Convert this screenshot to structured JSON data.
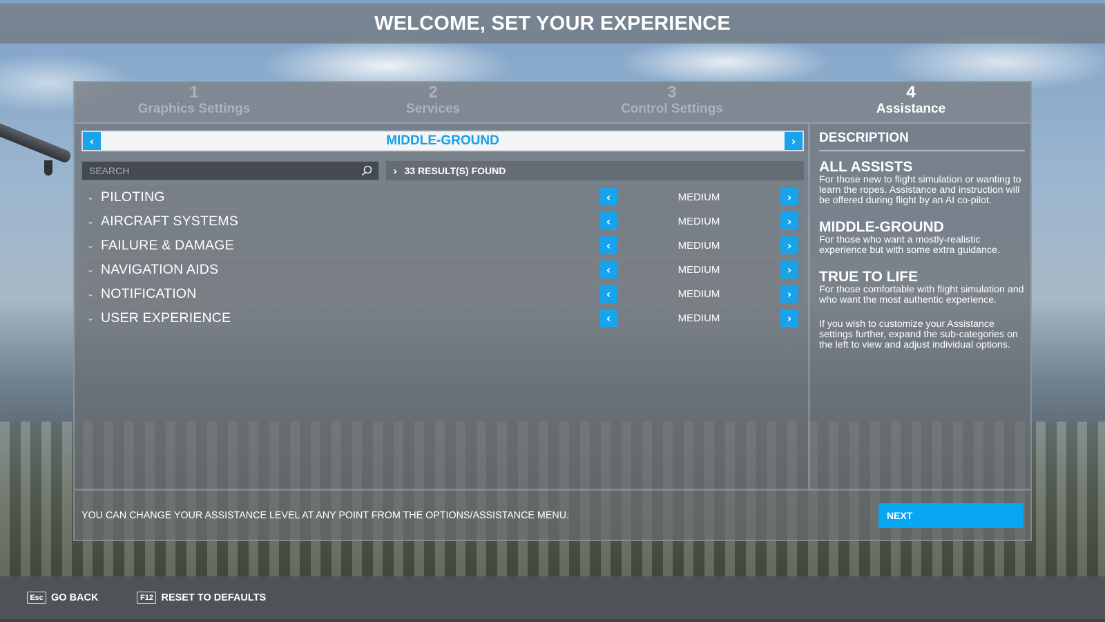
{
  "header": {
    "title": "WELCOME, SET YOUR EXPERIENCE"
  },
  "steps": [
    {
      "number": "1",
      "label": "Graphics Settings",
      "active": false
    },
    {
      "number": "2",
      "label": "Services",
      "active": false
    },
    {
      "number": "3",
      "label": "Control Settings",
      "active": false
    },
    {
      "number": "4",
      "label": "Assistance",
      "active": true
    }
  ],
  "preset": {
    "title": "MIDDLE-GROUND",
    "prev_icon": "chevron-left-icon",
    "next_icon": "chevron-right-icon"
  },
  "search": {
    "placeholder": "SEARCH",
    "value": "",
    "results_text": "33 RESULT(S) FOUND"
  },
  "categories": [
    {
      "name": "PILOTING",
      "value": "MEDIUM"
    },
    {
      "name": "AIRCRAFT SYSTEMS",
      "value": "MEDIUM"
    },
    {
      "name": "FAILURE & DAMAGE",
      "value": "MEDIUM"
    },
    {
      "name": "NAVIGATION AIDS",
      "value": "MEDIUM"
    },
    {
      "name": "NOTIFICATION",
      "value": "MEDIUM"
    },
    {
      "name": "USER EXPERIENCE",
      "value": "MEDIUM"
    }
  ],
  "description": {
    "heading": "DESCRIPTION",
    "sections": [
      {
        "title": "ALL ASSISTS",
        "text": "For those new to flight simulation or wanting to learn the ropes. Assistance and instruction will be offered during flight by an AI co-pilot."
      },
      {
        "title": "MIDDLE-GROUND",
        "text": "For those who want a mostly-realistic experience but with some extra guidance."
      },
      {
        "title": "TRUE TO LIFE",
        "text": "For those comfortable with flight simulation and who want the most authentic experience."
      }
    ],
    "extra": "If you wish to customize your Assistance settings further, expand the sub-categories on the left to view and adjust individual options."
  },
  "bottom": {
    "notice": "YOU CAN CHANGE YOUR ASSISTANCE LEVEL AT ANY POINT FROM THE OPTIONS/ASSISTANCE MENU.",
    "next_label": "NEXT"
  },
  "footer": {
    "back_key": "Esc",
    "back_label": "GO BACK",
    "reset_key": "F12",
    "reset_label": "RESET TO DEFAULTS"
  },
  "colors": {
    "accent": "#17a4ec",
    "next_button": "#07a6f0",
    "preset_text": "#16a0e6"
  }
}
